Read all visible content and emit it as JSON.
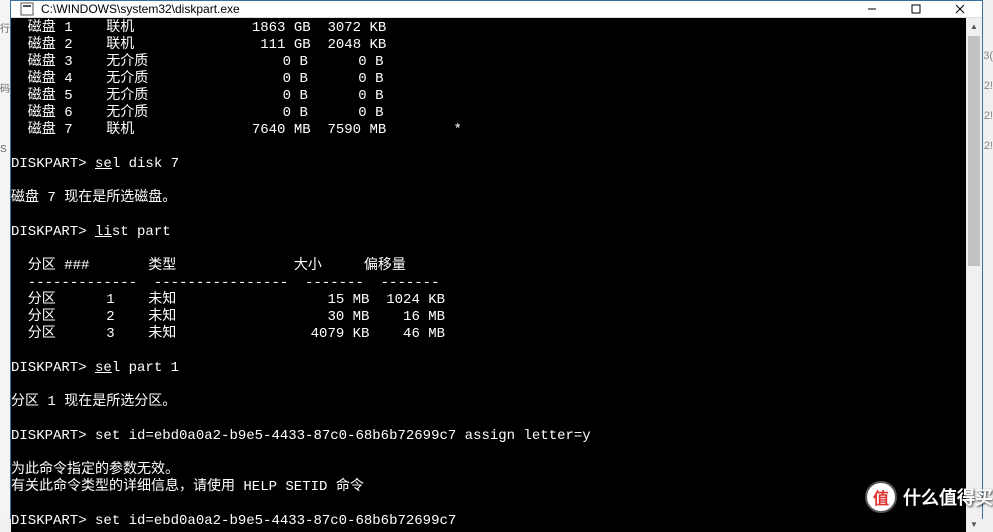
{
  "window": {
    "title": "C:\\WINDOWS\\system32\\diskpart.exe"
  },
  "left_edge": {
    "chars": "行\n码\nS"
  },
  "background_hints": [
    "3(",
    "2!",
    "2!",
    "2!"
  ],
  "terminal": {
    "disk_header_cols": [
      "磁盘",
      "",
      "",
      "",
      ""
    ],
    "disks": [
      {
        "label": "  磁盘 1",
        "status": "联机",
        "size": "1863 GB",
        "free": "3072 KB",
        "mark": ""
      },
      {
        "label": "  磁盘 2",
        "status": "联机",
        "size": "111 GB",
        "free": "2048 KB",
        "mark": ""
      },
      {
        "label": "  磁盘 3",
        "status": "无介质",
        "size": "0 B",
        "free": "0 B",
        "mark": ""
      },
      {
        "label": "  磁盘 4",
        "status": "无介质",
        "size": "0 B",
        "free": "0 B",
        "mark": ""
      },
      {
        "label": "  磁盘 5",
        "status": "无介质",
        "size": "0 B",
        "free": "0 B",
        "mark": ""
      },
      {
        "label": "  磁盘 6",
        "status": "无介质",
        "size": "0 B",
        "free": "0 B",
        "mark": ""
      },
      {
        "label": "  磁盘 7",
        "status": "联机",
        "size": "7640 MB",
        "free": "7590 MB",
        "mark": "*"
      }
    ],
    "prompt1": "DISKPART> ",
    "cmd1_u": "se",
    "cmd1_rest": "l disk 7",
    "resp1": "磁盘 7 现在是所选磁盘。",
    "prompt2": "DISKPART> ",
    "cmd2_u": "li",
    "cmd2_rest": "st part",
    "part_header": "  分区 ###       类型              大小     偏移量",
    "part_divider": "  -------------  ----------------  -------  -------",
    "partitions": [
      {
        "line": "  分区      1    未知                  15 MB  1024 KB"
      },
      {
        "line": "  分区      2    未知                  30 MB    16 MB"
      },
      {
        "line": "  分区      3    未知                4079 KB    46 MB"
      }
    ],
    "prompt3": "DISKPART> ",
    "cmd3_u": "se",
    "cmd3_rest": "l part 1",
    "resp3": "分区 1 现在是所选分区。",
    "prompt4": "DISKPART> ",
    "cmd4": "set id=ebd0a0a2-b9e5-4433-87c0-68b6b72699c7 assign letter=y",
    "err1": "为此命令指定的参数无效。",
    "err2": "有关此命令类型的详细信息，请使用 HELP SETID 命令",
    "prompt5": "DISKPART> ",
    "cmd5": "set id=ebd0a0a2-b9e5-4433-87c0-68b6b72699c7"
  },
  "watermark": {
    "badge": "值",
    "text": "什么值得买"
  }
}
